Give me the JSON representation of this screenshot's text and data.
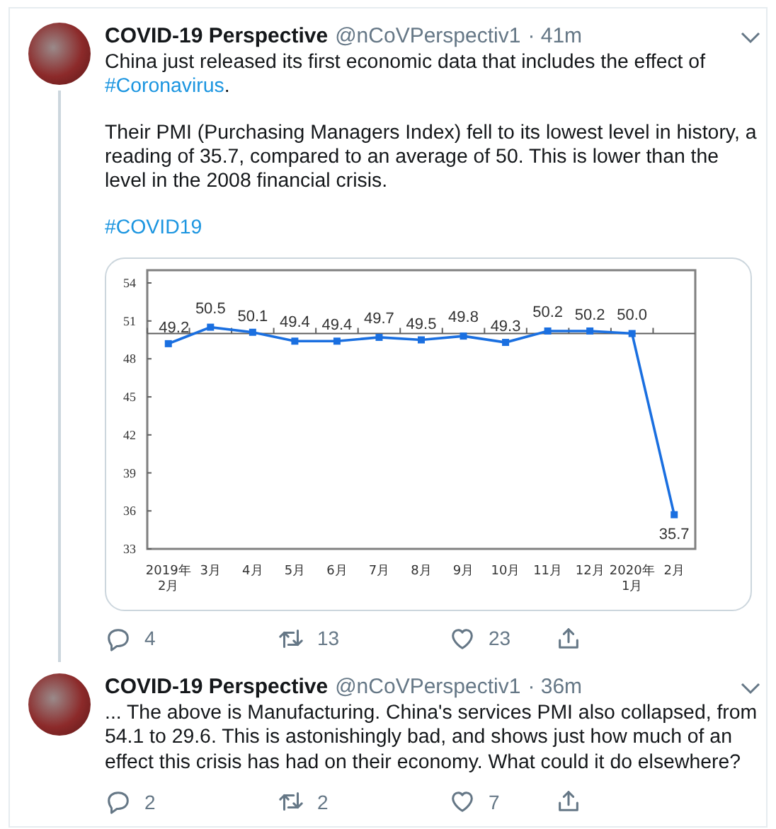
{
  "tweets": [
    {
      "author": {
        "name": "COVID-19 Perspective",
        "handle": "@nCoVPerspectiv1"
      },
      "time": "· 41m",
      "threaded": true,
      "paragraphs": [
        [
          {
            "kind": "text",
            "text": "China just released its first economic data that includes the effect of "
          },
          {
            "kind": "link",
            "text": "#Coronavirus"
          },
          {
            "kind": "text",
            "text": "."
          }
        ],
        [
          {
            "kind": "text",
            "text": "Their PMI (Purchasing Managers Index) fell to its lowest level in history, a reading of 35.7, compared to an average of 50. This is lower than the level in the 2008 financial crisis."
          }
        ],
        [
          {
            "kind": "link",
            "text": "#COVID19"
          }
        ]
      ],
      "chart_data": {
        "type": "line",
        "categories": [
          "2019年 2月",
          "3月",
          "4月",
          "5月",
          "6月",
          "7月",
          "8月",
          "9月",
          "10月",
          "11月",
          "12月",
          "2020年 1月",
          "2月"
        ],
        "series": [
          {
            "color": "#1a6fe0",
            "marker": "square",
            "values": [
              49.2,
              50.5,
              50.1,
              49.4,
              49.4,
              49.7,
              49.5,
              49.8,
              49.3,
              50.2,
              50.2,
              50.0,
              35.7
            ]
          }
        ],
        "ylim": [
          33,
          55
        ],
        "yticks": [
          33,
          36,
          39,
          42,
          45,
          48,
          51,
          54
        ],
        "ref_lines": [
          {
            "axis": "y",
            "value": 50
          }
        ],
        "value_labels": [
          "49.2",
          "50.5",
          "50.1",
          "49.4",
          "49.4",
          "49.7",
          "49.5",
          "49.8",
          "49.3",
          "50.2",
          "50.2",
          "50.0",
          "35.7"
        ]
      },
      "actions": [
        {
          "kind": "reply",
          "count": "4"
        },
        {
          "kind": "retweet",
          "count": "13"
        },
        {
          "kind": "like",
          "count": "23"
        },
        {
          "kind": "share"
        }
      ]
    },
    {
      "author": {
        "name": "COVID-19 Perspective",
        "handle": "@nCoVPerspectiv1"
      },
      "time": "· 36m",
      "threaded": false,
      "paragraphs": [
        [
          {
            "kind": "text",
            "text": "... The above is Manufacturing. China's services PMI also collapsed, from 54.1 to 29.6. This is astonishingly bad, and shows just how much of an effect this crisis has had on their economy. What could it do elsewhere?"
          }
        ]
      ],
      "actions": [
        {
          "kind": "reply",
          "count": "2"
        },
        {
          "kind": "retweet",
          "count": "2"
        },
        {
          "kind": "like",
          "count": "7"
        },
        {
          "kind": "share"
        }
      ]
    }
  ]
}
